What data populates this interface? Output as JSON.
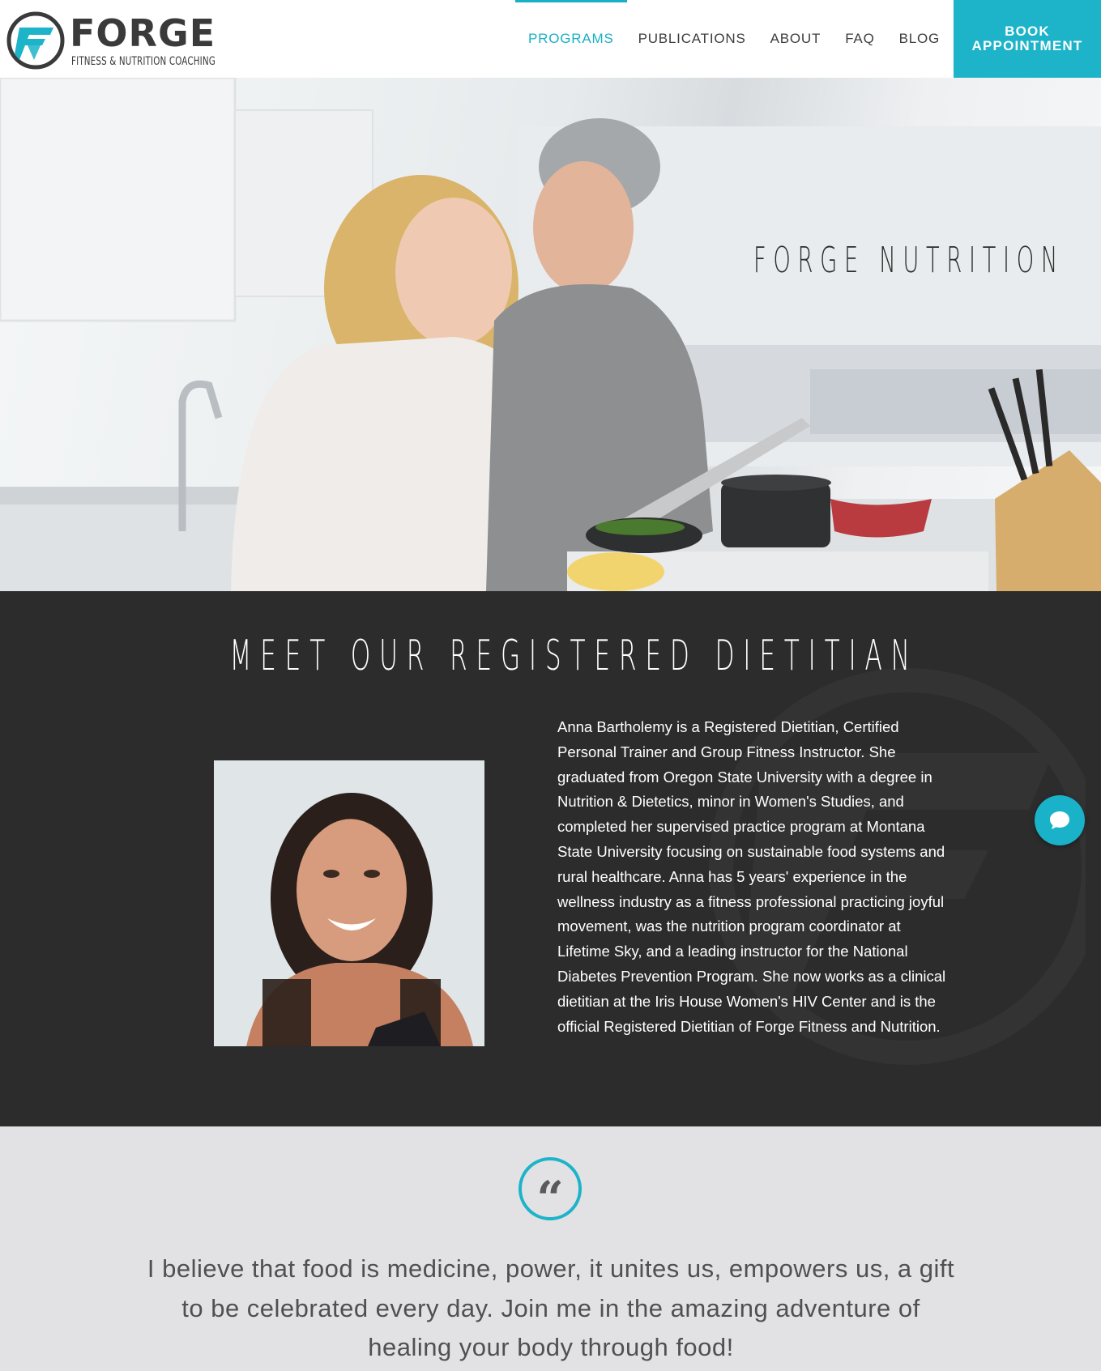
{
  "header": {
    "logo": {
      "wordmark": "FORGE",
      "tagline": "FITNESS & NUTRITION COACHING",
      "icon": "forge-f-logo-icon"
    },
    "nav": [
      {
        "label": "PROGRAMS",
        "active": true
      },
      {
        "label": "PUBLICATIONS",
        "active": false
      },
      {
        "label": "ABOUT",
        "active": false
      },
      {
        "label": "FAQ",
        "active": false
      },
      {
        "label": "BLOG",
        "active": false
      }
    ],
    "book_button": "BOOK APPOINTMENT"
  },
  "hero": {
    "title": "FORGE NUTRITION"
  },
  "dietitian": {
    "title": "MEET OUR REGISTERED DIETITIAN",
    "bio": "Anna Bartholemy is a Registered Dietitian, Certified Personal Trainer and Group Fitness Instructor. She graduated from Oregon State University with a degree in Nutrition & Dietetics, minor in Women's Studies, and completed her supervised practice program at Montana State University focusing on sustainable food systems and rural healthcare. Anna has 5 years' experience in the wellness industry as a fitness professional practicing joyful movement, was the nutrition program coordinator at Lifetime Sky, and a leading instructor for the National Diabetes Prevention Program. She now works as a clinical dietitian at the Iris House Women's HIV Center and is the official Registered Dietitian of Forge Fitness and Nutrition.",
    "chat_icon": "chat-bubble-icon"
  },
  "quote": {
    "icon": "quote-mark-icon",
    "mark": "“",
    "text": "I believe that food is medicine, power, it unites us, empowers us, a gift to be celebrated every day. Join me in the amazing adventure of healing your body through food!"
  },
  "colors": {
    "accent": "#1db3c9",
    "dark_section": "#2c2c2d",
    "quote_section": "#e2e2e4",
    "text_dark": "#3d3d3d"
  }
}
